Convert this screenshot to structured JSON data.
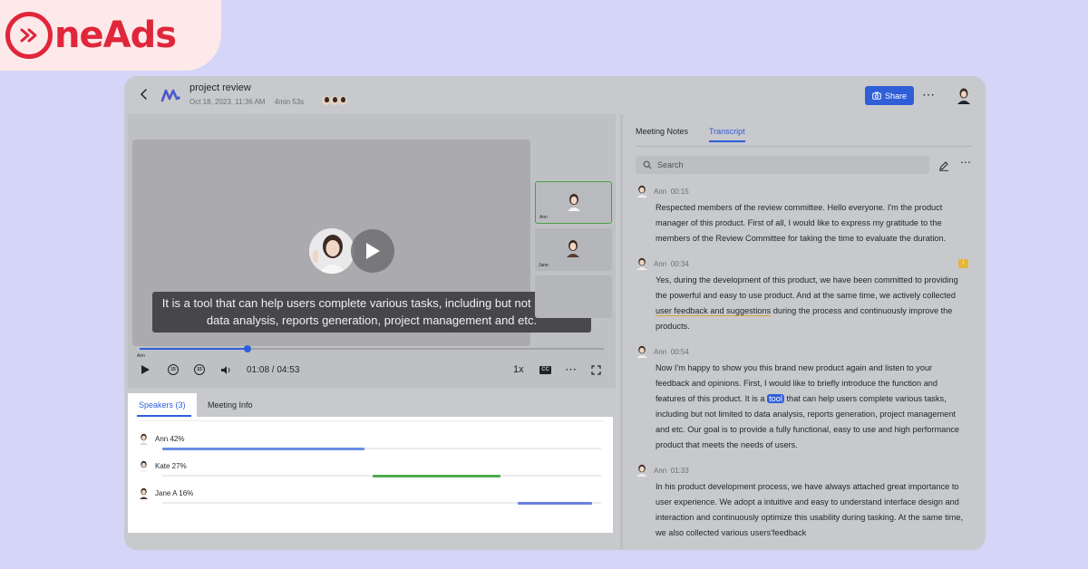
{
  "brand": {
    "name": "neAds",
    "color": "#e0263a"
  },
  "header": {
    "back_icon": "chevron-left-icon",
    "title": "project review",
    "date": "Oct 18, 2023, 11:36 AM",
    "duration": "4min 53s",
    "share_label": "Share",
    "accent": "#2f5ed9"
  },
  "player": {
    "caption": "It is a tool that can help users complete various tasks, including but not limited to data analysis, reports generation, project management and etc.",
    "progress": 0.233,
    "progress_label": "Ann",
    "time": "01:08 / 04:53",
    "speed": "1x",
    "cc": "CC",
    "rewind_label": "15",
    "forward_label": "15",
    "thumbnails": [
      {
        "label": "Ann",
        "active": true
      },
      {
        "label": "Jane",
        "active": false
      },
      {
        "label": "",
        "active": false
      }
    ]
  },
  "bottom_tabs": [
    {
      "label": "Speakers (3)",
      "active": true
    },
    {
      "label": "Meeting Info",
      "active": false
    }
  ],
  "speakers": [
    {
      "name": "Ann 42%",
      "color": "#6a8ce2",
      "segments": [
        [
          0.0,
          0.46
        ]
      ]
    },
    {
      "name": "Kate 27%",
      "color": "#4caa4c",
      "segments": [
        [
          0.48,
          0.77
        ]
      ]
    },
    {
      "name": "Jane A 16%",
      "color": "#6a7fe0",
      "segments": [
        [
          0.81,
          0.98
        ]
      ]
    }
  ],
  "right_tabs": [
    {
      "label": "Meeting Notes",
      "active": false
    },
    {
      "label": "Transcript",
      "active": true
    }
  ],
  "search": {
    "placeholder": "Search"
  },
  "transcript": [
    {
      "speaker": "Ann",
      "time": "00:15",
      "text": "Respected members of the review committee. Hello everyone. I'm the product manager of this product. First of all, I would like to express my gratitude to the members of the Review Committee for taking the time to evaluate the duration."
    },
    {
      "speaker": "Ann",
      "time": "00:34",
      "text_before": "Yes, during the development of this product, we have been committed to providing the powerful and easy to use product. And at the same time, we actively collected ",
      "text_underline": "user feedback and suggestions",
      "text_after": " during the process and continuously improve the products.",
      "comment_flag": "!"
    },
    {
      "speaker": "Ann",
      "time": "00:54",
      "text_before": "Now I'm happy to show you this brand new product again and listen to your feedback and opinions. First, I would like to briefly introduce the function and features of this product. It is a ",
      "text_highlight": "tool",
      "text_after": " that can help users complete various tasks, including but not limited to data analysis, reports generation, project management and etc. Our goal is to provide a fully functional, easy to use and high performance product that meets the needs of users."
    },
    {
      "speaker": "Ann",
      "time": "01:33",
      "text": "In his product development process, we have always attached great importance to user experience. We adopt a intuitive and easy to understand interface design and interaction and continuously optimize this usability during tasking. At the same time, we also collected various users'feedback"
    }
  ]
}
